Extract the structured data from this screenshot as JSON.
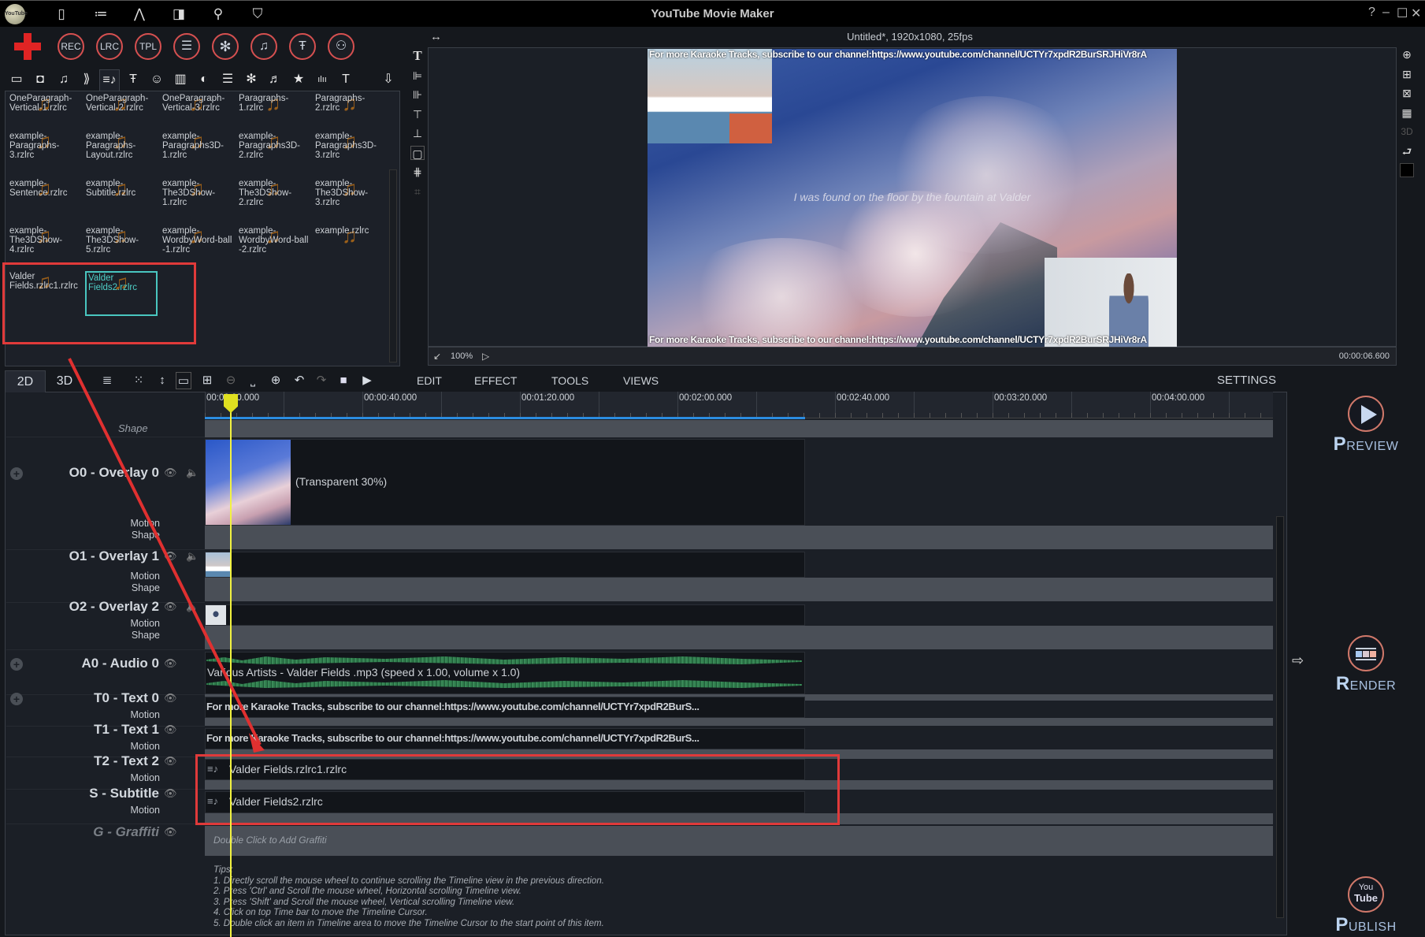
{
  "app": {
    "title": "YouTube Movie Maker",
    "logo_text": "YouTube"
  },
  "titlebar": {
    "icons": [
      "door-icon",
      "list-icon",
      "pen-icon",
      "layout-icon",
      "search-icon",
      "shirt-icon"
    ],
    "help": "?",
    "minimize": "–",
    "maximize": "☐",
    "close": "✕"
  },
  "toolbar": {
    "add_label": "+",
    "buttons": [
      {
        "name": "rec",
        "label": "REC"
      },
      {
        "name": "lrc",
        "label": "LRC"
      },
      {
        "name": "tpl",
        "label": "TPL"
      },
      {
        "name": "list",
        "label": "☰"
      },
      {
        "name": "flower",
        "label": "✻"
      },
      {
        "name": "music-score",
        "label": "♫"
      },
      {
        "name": "text-style",
        "label": "Ŧ"
      },
      {
        "name": "user",
        "label": "⚇"
      }
    ]
  },
  "library_tabs": [
    {
      "name": "layout",
      "glyph": "▭"
    },
    {
      "name": "camera",
      "glyph": "◘"
    },
    {
      "name": "music",
      "glyph": "♫"
    },
    {
      "name": "transition",
      "glyph": "⟫"
    },
    {
      "name": "lyrics",
      "glyph": "≡♪",
      "active": true
    },
    {
      "name": "text-effect",
      "glyph": "Ŧ"
    },
    {
      "name": "emoji",
      "glyph": "☺"
    },
    {
      "name": "battery",
      "glyph": "▥"
    },
    {
      "name": "contrast",
      "glyph": "◐"
    },
    {
      "name": "list",
      "glyph": "☰"
    },
    {
      "name": "flower",
      "glyph": "✻"
    },
    {
      "name": "score",
      "glyph": "♬"
    },
    {
      "name": "star",
      "glyph": "★"
    },
    {
      "name": "equalizer",
      "glyph": "ılıı"
    },
    {
      "name": "text",
      "glyph": "T"
    },
    {
      "name": "download",
      "glyph": "⇩"
    }
  ],
  "library_items": [
    [
      "OneParagraph-",
      "Vertical-1.rzlrc"
    ],
    [
      "OneParagraph-",
      "Vertical-2.rzlrc"
    ],
    [
      "OneParagraph-",
      "Vertical-3.rzlrc"
    ],
    [
      "Paragraphs-",
      "1.rzlrc"
    ],
    [
      "Paragraphs-",
      "2.rzlrc"
    ],
    [
      "example-",
      "Paragraphs-",
      "3.rzlrc"
    ],
    [
      "example-",
      "Paragraphs-",
      "Layout.rzlrc"
    ],
    [
      "example-",
      "Paragraphs3D-",
      "1.rzlrc"
    ],
    [
      "example-",
      "Paragraphs3D-",
      "2.rzlrc"
    ],
    [
      "example-",
      "Paragraphs3D-",
      "3.rzlrc"
    ],
    [
      "example-",
      "Sentence.rzlrc"
    ],
    [
      "example-",
      "Subtitle.rzlrc"
    ],
    [
      "example-",
      "The3DShow-",
      "1.rzlrc"
    ],
    [
      "example-",
      "The3DShow-",
      "2.rzlrc"
    ],
    [
      "example-",
      "The3DShow-",
      "3.rzlrc"
    ],
    [
      "example-",
      "The3DShow-",
      "4.rzlrc"
    ],
    [
      "example-",
      "The3DShow-",
      "5.rzlrc"
    ],
    [
      "example-",
      "WordbyWord-ball",
      "-1.rzlrc"
    ],
    [
      "example-",
      "WordbyWord-ball",
      "-2.rzlrc"
    ],
    [
      "example.rzlrc"
    ],
    [
      "Valder",
      "Fields.rzlrc1.rzlrc"
    ],
    [
      "Valder",
      "Fields2.rzlrc"
    ]
  ],
  "library_selected_index": 21,
  "preview": {
    "header": "Untitled*, 1920x1080, 25fps",
    "top_caption": "For more Karaoke Tracks, subscribe to our channel:https://www.youtube.com/channel/UCTYr7xpdR2BurSRJHiVr8rA",
    "bottom_caption": "For more Karaoke Tracks, subscribe to our channel:https://www.youtube.com/channel/UCTYr7xpdR2BurSRJHiVr8rA",
    "lyric": "I was found on the floor by the fountain at Valder",
    "zoom": "100%",
    "time": "00:00:06.600",
    "expand_icon": "↔"
  },
  "align_tools": [
    "T",
    "⊫",
    "⊪",
    "⊤",
    "⊥",
    "▢",
    "⋕",
    "⌗"
  ],
  "right_tools": [
    "⊕",
    "⊞",
    "⊠",
    "▦",
    "3D",
    "⮐",
    "■"
  ],
  "timeline": {
    "tabs": [
      {
        "label": "2D",
        "active": true
      },
      {
        "label": "3D"
      }
    ],
    "tools": [
      "≣",
      "⁙",
      "↕",
      "▭",
      "⊞",
      "⊖",
      "⎵",
      "⊕",
      "↶",
      "↷",
      "■",
      "▶"
    ],
    "menus": [
      "EDIT",
      "EFFECT",
      "TOOLS",
      "VIEWS"
    ],
    "settings": "SETTINGS",
    "ruler": [
      "00:00:00.000",
      "00:00:40.000",
      "00:01:20.000",
      "00:02:00.000",
      "00:02:40.000",
      "00:03:20.000",
      "00:04:00.000"
    ],
    "shape_label": "Shape",
    "tracks": [
      {
        "id": "O0",
        "label": "O0 - Overlay 0",
        "subs": [
          "Motion",
          "Shape"
        ],
        "clip_text": "(Transparent 30%)"
      },
      {
        "id": "O1",
        "label": "O1 - Overlay 1",
        "subs": [
          "Motion",
          "Shape"
        ],
        "clip_text": ""
      },
      {
        "id": "O2",
        "label": "O2 - Overlay 2",
        "subs": [
          "Motion",
          "Shape"
        ],
        "clip_text": ""
      },
      {
        "id": "A0",
        "label": "A0 - Audio 0",
        "subs": [],
        "clip_text": "Various Artists - Valder Fields .mp3  (speed x 1.00, volume x 1.0)"
      },
      {
        "id": "T0",
        "label": "T0 - Text 0",
        "subs": [
          "Motion"
        ],
        "clip_text": "For more Karaoke Tracks, subscribe to our channel:https://www.youtube.com/channel/UCTYr7xpdR2BurS..."
      },
      {
        "id": "T1",
        "label": "T1 - Text 1",
        "subs": [
          "Motion"
        ],
        "clip_text": "For more Karaoke Tracks, subscribe to our channel:https://www.youtube.com/channel/UCTYr7xpdR2BurS..."
      },
      {
        "id": "T2",
        "label": "T2 - Text 2",
        "subs": [
          "Motion"
        ],
        "clip_text": "Valder Fields.rzlrc1.rzlrc"
      },
      {
        "id": "S",
        "label": "S - Subtitle",
        "subs": [
          "Motion"
        ],
        "clip_text": "Valder Fields2.rzlrc"
      },
      {
        "id": "G",
        "label": "G - Graffiti",
        "subs": [],
        "clip_text": "Double Click to Add Graffiti"
      }
    ],
    "tips": [
      "Tips:",
      "1. Directly scroll the mouse wheel to continue scrolling the Timeline view in the previous direction.",
      "2. Press 'Ctrl' and Scroll the mouse wheel, Horizontal scrolling Timeline view.",
      "3. Press 'Shift' and Scroll the mouse wheel, Vertical scrolling Timeline view.",
      "4. Click on top Time bar to move the Timeline Cursor.",
      "5. Double click an item in Timeline area to move the Timeline Cursor to the start point of this item."
    ]
  },
  "actions": {
    "preview": {
      "first": "P",
      "rest": "REVIEW"
    },
    "render": {
      "first": "R",
      "rest": "ENDER"
    },
    "publish": {
      "first": "P",
      "rest": "UBLISH",
      "badge_top": "You",
      "badge_bottom": "Tube"
    },
    "collapse_arrow": "⇨"
  },
  "colors": {
    "accent_red": "#e03a3a",
    "selection": "#49c6c0",
    "cursor": "#f2f240",
    "progress": "#2b8ce0"
  }
}
